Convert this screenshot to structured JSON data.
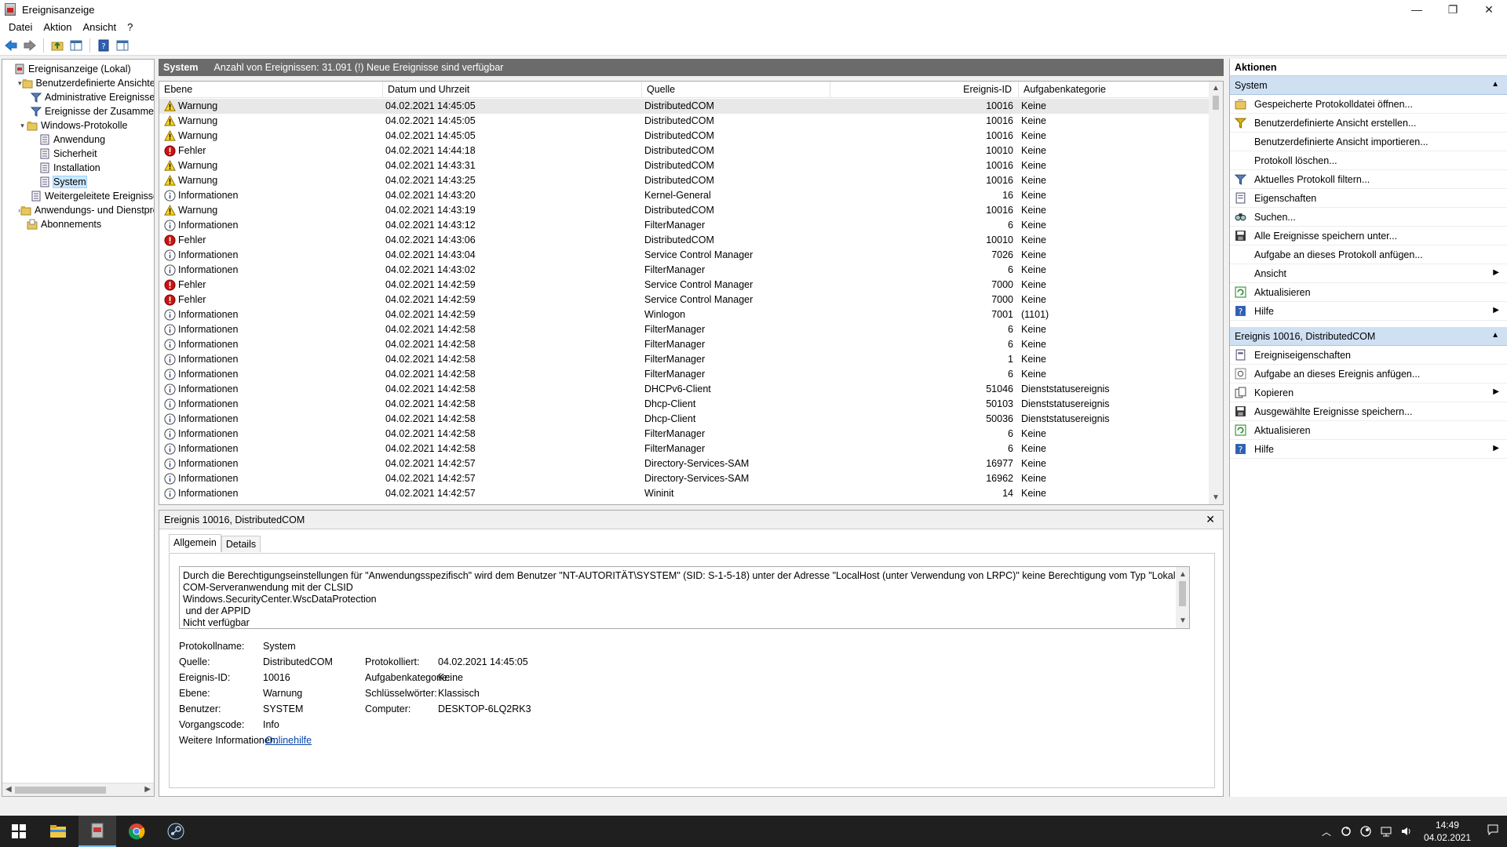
{
  "window": {
    "title": "Ereignisanzeige",
    "minimize": "—",
    "restore": "❐",
    "close": "✕"
  },
  "menu": [
    "Datei",
    "Aktion",
    "Ansicht",
    "?"
  ],
  "tree": [
    {
      "label": "Ereignisanzeige (Lokal)",
      "indent": 0,
      "exp": "",
      "icon": "event-viewer-icon"
    },
    {
      "label": "Benutzerdefinierte Ansichten",
      "indent": 1,
      "exp": "▾",
      "icon": "folder-icon"
    },
    {
      "label": "Administrative Ereignisse",
      "indent": 2,
      "exp": "",
      "icon": "filter-icon"
    },
    {
      "label": "Ereignisse der Zusammenfassung",
      "indent": 2,
      "exp": "",
      "icon": "filter-icon"
    },
    {
      "label": "Windows-Protokolle",
      "indent": 1,
      "exp": "▾",
      "icon": "folder-icon"
    },
    {
      "label": "Anwendung",
      "indent": 2,
      "exp": "",
      "icon": "log-icon"
    },
    {
      "label": "Sicherheit",
      "indent": 2,
      "exp": "",
      "icon": "log-icon"
    },
    {
      "label": "Installation",
      "indent": 2,
      "exp": "",
      "icon": "log-icon"
    },
    {
      "label": "System",
      "indent": 2,
      "exp": "",
      "icon": "log-icon",
      "selected": true
    },
    {
      "label": "Weitergeleitete Ereignisse",
      "indent": 2,
      "exp": "",
      "icon": "log-icon"
    },
    {
      "label": "Anwendungs- und Dienstprotokolle",
      "indent": 1,
      "exp": "›",
      "icon": "folder-icon"
    },
    {
      "label": "Abonnements",
      "indent": 1,
      "exp": "",
      "icon": "subscription-icon"
    }
  ],
  "center_header": {
    "log_name": "System",
    "summary": "Anzahl von Ereignissen: 31.091 (!) Neue Ereignisse sind verfügbar"
  },
  "columns": [
    "Ebene",
    "Datum und Uhrzeit",
    "Quelle",
    "Ereignis-ID",
    "Aufgabenkategorie"
  ],
  "events": [
    {
      "level": "Warnung",
      "type": "warning",
      "date": "04.02.2021 14:45:05",
      "source": "DistributedCOM",
      "id": "10016",
      "category": "Keine"
    },
    {
      "level": "Warnung",
      "type": "warning",
      "date": "04.02.2021 14:45:05",
      "source": "DistributedCOM",
      "id": "10016",
      "category": "Keine"
    },
    {
      "level": "Warnung",
      "type": "warning",
      "date": "04.02.2021 14:45:05",
      "source": "DistributedCOM",
      "id": "10016",
      "category": "Keine"
    },
    {
      "level": "Fehler",
      "type": "error",
      "date": "04.02.2021 14:44:18",
      "source": "DistributedCOM",
      "id": "10010",
      "category": "Keine"
    },
    {
      "level": "Warnung",
      "type": "warning",
      "date": "04.02.2021 14:43:31",
      "source": "DistributedCOM",
      "id": "10016",
      "category": "Keine"
    },
    {
      "level": "Warnung",
      "type": "warning",
      "date": "04.02.2021 14:43:25",
      "source": "DistributedCOM",
      "id": "10016",
      "category": "Keine"
    },
    {
      "level": "Informationen",
      "type": "info",
      "date": "04.02.2021 14:43:20",
      "source": "Kernel-General",
      "id": "16",
      "category": "Keine"
    },
    {
      "level": "Warnung",
      "type": "warning",
      "date": "04.02.2021 14:43:19",
      "source": "DistributedCOM",
      "id": "10016",
      "category": "Keine"
    },
    {
      "level": "Informationen",
      "type": "info",
      "date": "04.02.2021 14:43:12",
      "source": "FilterManager",
      "id": "6",
      "category": "Keine"
    },
    {
      "level": "Fehler",
      "type": "error",
      "date": "04.02.2021 14:43:06",
      "source": "DistributedCOM",
      "id": "10010",
      "category": "Keine"
    },
    {
      "level": "Informationen",
      "type": "info",
      "date": "04.02.2021 14:43:04",
      "source": "Service Control Manager",
      "id": "7026",
      "category": "Keine"
    },
    {
      "level": "Informationen",
      "type": "info",
      "date": "04.02.2021 14:43:02",
      "source": "FilterManager",
      "id": "6",
      "category": "Keine"
    },
    {
      "level": "Fehler",
      "type": "error",
      "date": "04.02.2021 14:42:59",
      "source": "Service Control Manager",
      "id": "7000",
      "category": "Keine"
    },
    {
      "level": "Fehler",
      "type": "error",
      "date": "04.02.2021 14:42:59",
      "source": "Service Control Manager",
      "id": "7000",
      "category": "Keine"
    },
    {
      "level": "Informationen",
      "type": "info",
      "date": "04.02.2021 14:42:59",
      "source": "Winlogon",
      "id": "7001",
      "category": "(1101)"
    },
    {
      "level": "Informationen",
      "type": "info",
      "date": "04.02.2021 14:42:58",
      "source": "FilterManager",
      "id": "6",
      "category": "Keine"
    },
    {
      "level": "Informationen",
      "type": "info",
      "date": "04.02.2021 14:42:58",
      "source": "FilterManager",
      "id": "6",
      "category": "Keine"
    },
    {
      "level": "Informationen",
      "type": "info",
      "date": "04.02.2021 14:42:58",
      "source": "FilterManager",
      "id": "1",
      "category": "Keine"
    },
    {
      "level": "Informationen",
      "type": "info",
      "date": "04.02.2021 14:42:58",
      "source": "FilterManager",
      "id": "6",
      "category": "Keine"
    },
    {
      "level": "Informationen",
      "type": "info",
      "date": "04.02.2021 14:42:58",
      "source": "DHCPv6-Client",
      "id": "51046",
      "category": "Dienststatusereignis"
    },
    {
      "level": "Informationen",
      "type": "info",
      "date": "04.02.2021 14:42:58",
      "source": "Dhcp-Client",
      "id": "50103",
      "category": "Dienststatusereignis"
    },
    {
      "level": "Informationen",
      "type": "info",
      "date": "04.02.2021 14:42:58",
      "source": "Dhcp-Client",
      "id": "50036",
      "category": "Dienststatusereignis"
    },
    {
      "level": "Informationen",
      "type": "info",
      "date": "04.02.2021 14:42:58",
      "source": "FilterManager",
      "id": "6",
      "category": "Keine"
    },
    {
      "level": "Informationen",
      "type": "info",
      "date": "04.02.2021 14:42:58",
      "source": "FilterManager",
      "id": "6",
      "category": "Keine"
    },
    {
      "level": "Informationen",
      "type": "info",
      "date": "04.02.2021 14:42:57",
      "source": "Directory-Services-SAM",
      "id": "16977",
      "category": "Keine"
    },
    {
      "level": "Informationen",
      "type": "info",
      "date": "04.02.2021 14:42:57",
      "source": "Directory-Services-SAM",
      "id": "16962",
      "category": "Keine"
    },
    {
      "level": "Informationen",
      "type": "info",
      "date": "04.02.2021 14:42:57",
      "source": "Wininit",
      "id": "14",
      "category": "Keine"
    }
  ],
  "detail": {
    "title": "Ereignis 10016, DistributedCOM",
    "close": "✕",
    "tabs": [
      "Allgemein",
      "Details"
    ],
    "description": [
      "Durch die Berechtigungseinstellungen für \"Anwendungsspezifisch\" wird dem Benutzer \"NT-AUTORITÄT\\SYSTEM\" (SID: S-1-5-18) unter der Adresse \"LocalHost (unter Verwendung von LRPC)\" keine Berechtigung vom Typ \"Lokal Start\" für die",
      "COM-Serveranwendung mit der CLSID",
      "Windows.SecurityCenter.WscDataProtection",
      " und der APPID",
      "Nicht verfügbar"
    ],
    "labels": {
      "log_name": "Protokollname:",
      "source": "Quelle:",
      "event_id": "Ereignis-ID:",
      "level": "Ebene:",
      "user": "Benutzer:",
      "opcode": "Vorgangscode:",
      "more_info": "Weitere Informationen:",
      "logged": "Protokolliert:",
      "task_category": "Aufgabenkategorie:",
      "keywords": "Schlüsselwörter:",
      "computer": "Computer:"
    },
    "values": {
      "log_name": "System",
      "source": "DistributedCOM",
      "event_id": "10016",
      "level": "Warnung",
      "user": "SYSTEM",
      "opcode": "Info",
      "more_info": "Onlinehilfe",
      "logged": "04.02.2021 14:45:05",
      "task_category": "Keine",
      "keywords": "Klassisch",
      "computer": "DESKTOP-6LQ2RK3"
    }
  },
  "actions": {
    "title": "Aktionen",
    "sections": [
      {
        "name": "System",
        "items": [
          {
            "label": "Gespeicherte Protokolldatei öffnen...",
            "icon": "open-log-icon"
          },
          {
            "label": "Benutzerdefinierte Ansicht erstellen...",
            "icon": "create-view-icon"
          },
          {
            "label": "Benutzerdefinierte Ansicht importieren...",
            "icon": ""
          },
          {
            "label": "Protokoll löschen...",
            "icon": ""
          },
          {
            "label": "Aktuelles Protokoll filtern...",
            "icon": "filter-icon"
          },
          {
            "label": "Eigenschaften",
            "icon": "properties-icon"
          },
          {
            "label": "Suchen...",
            "icon": "find-icon"
          },
          {
            "label": "Alle Ereignisse speichern unter...",
            "icon": "save-icon"
          },
          {
            "label": "Aufgabe an dieses Protokoll anfügen...",
            "icon": ""
          },
          {
            "label": "Ansicht",
            "icon": "",
            "submenu": true
          },
          {
            "label": "Aktualisieren",
            "icon": "refresh-icon"
          },
          {
            "label": "Hilfe",
            "icon": "help-icon",
            "submenu": true
          }
        ]
      },
      {
        "name": "Ereignis 10016, DistributedCOM",
        "items": [
          {
            "label": "Ereigniseigenschaften",
            "icon": "event-properties-icon"
          },
          {
            "label": "Aufgabe an dieses Ereignis anfügen...",
            "icon": "attach-task-icon"
          },
          {
            "label": "Kopieren",
            "icon": "copy-icon",
            "submenu": true
          },
          {
            "label": "Ausgewählte Ereignisse speichern...",
            "icon": "save-icon"
          },
          {
            "label": "Aktualisieren",
            "icon": "refresh-icon"
          },
          {
            "label": "Hilfe",
            "icon": "help-icon",
            "submenu": true
          }
        ]
      }
    ]
  },
  "taskbar": {
    "time": "14:49",
    "date": "04.02.2021"
  }
}
